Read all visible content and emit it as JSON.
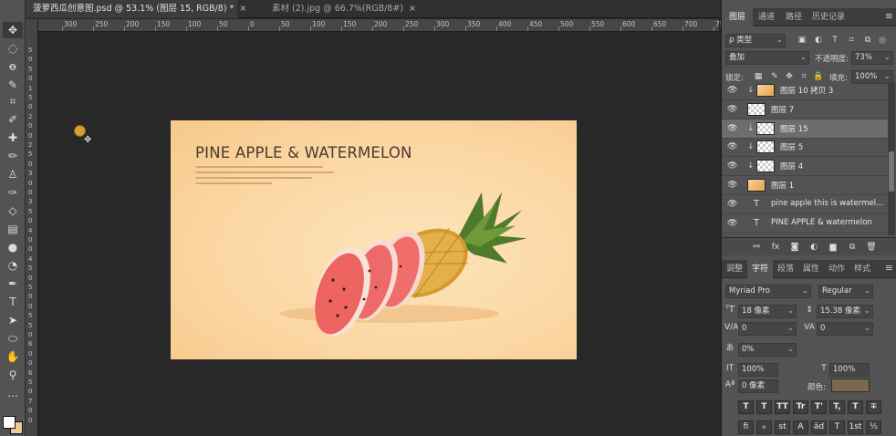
{
  "tabs": [
    {
      "label": "菠萝西瓜创意图.psd @ 53.1% (图层 15, RGB/8) *",
      "close": "×"
    },
    {
      "label": "素材 (2).jpg @ 66.7%(RGB/8#)",
      "close": "×"
    }
  ],
  "ruler": {
    "top_labels": [
      "300",
      "250",
      "200",
      "150",
      "100",
      "50",
      "0",
      "50",
      "100",
      "150",
      "200",
      "250",
      "300",
      "350",
      "400",
      "450",
      "500",
      "550",
      "600",
      "650",
      "700",
      "750"
    ],
    "left_labels": [
      "5",
      "0",
      "5",
      "0",
      "1",
      "5",
      "0",
      "2",
      "0",
      "0",
      "2",
      "5",
      "0",
      "3",
      "0",
      "0",
      "3",
      "5",
      "0",
      "4",
      "0",
      "0",
      "4",
      "5",
      "0",
      "5",
      "0",
      "0",
      "5",
      "5",
      "0",
      "6",
      "0",
      "0",
      "6",
      "5",
      "0",
      "7",
      "0",
      "0"
    ]
  },
  "toolbar": {
    "tools": [
      "move-tool",
      "marquee-tool",
      "lasso-tool",
      "quick-select-tool",
      "crop-tool",
      "eyedropper-tool",
      "healing-brush-tool",
      "brush-tool",
      "clone-stamp-tool",
      "history-brush-tool",
      "eraser-tool",
      "gradient-tool",
      "blur-tool",
      "dodge-tool",
      "pen-tool",
      "type-tool",
      "path-select-tool",
      "shape-tool",
      "hand-tool",
      "zoom-tool",
      "more-tools"
    ],
    "glyphs": [
      "✥",
      "◌",
      "ꝋ",
      "✎",
      "⌗",
      "✐",
      "✚",
      "✏",
      "♙",
      "✑",
      "◇",
      "▤",
      "●",
      "◔",
      "✒",
      "T",
      "➤",
      "⬭",
      "✋",
      "⚲",
      "…"
    ]
  },
  "artboard": {
    "title": "PINE APPLE & WATERMELON"
  },
  "layers_panel": {
    "tabs": [
      "图层",
      "通道",
      "路径",
      "历史记录"
    ],
    "filter_kind": "ρ 类型",
    "blend_mode": "叠加",
    "opacity_label": "不透明度:",
    "opacity_value": "73%",
    "lock_label": "锁定:",
    "fill_label": "填充:",
    "fill_value": "100%",
    "layers": [
      {
        "name": "图层 10 拷贝 3",
        "kind": "image",
        "clipped": true
      },
      {
        "name": "图层 7",
        "kind": "pixel",
        "clipped": false
      },
      {
        "name": "图层 15",
        "kind": "pixel",
        "clipped": true,
        "selected": true
      },
      {
        "name": "图层 5",
        "kind": "pixel",
        "clipped": true
      },
      {
        "name": "图层 4",
        "kind": "pixel",
        "clipped": true
      },
      {
        "name": "图层 1",
        "kind": "image",
        "clipped": false
      },
      {
        "name": "pine apple this is watermel...",
        "kind": "text",
        "clipped": false
      },
      {
        "name": "PINE APPLE & watermelon",
        "kind": "text",
        "clipped": false
      }
    ],
    "footer_icons": [
      "link-icon",
      "fx-icon",
      "mask-icon",
      "adjustment-icon",
      "folder-icon",
      "new-layer-icon",
      "trash-icon"
    ],
    "footer_glyphs": [
      "⚯",
      "fx",
      "◙",
      "◐",
      "▆",
      "⧉",
      "🗑"
    ]
  },
  "character_panel": {
    "tabs": [
      "调整",
      "字符",
      "段落",
      "属性",
      "动作",
      "样式"
    ],
    "font_family": "Myriad Pro",
    "font_style": "Regular",
    "size_value": "18 像素",
    "leading_value": "15.38 像素",
    "kerning_value": "0",
    "tracking_value": "0",
    "scale_pct_value": "0%",
    "vertical_scale": "100%",
    "horizontal_scale": "100%",
    "baseline_value": "0 像素",
    "color_label": "颜色:",
    "color_hex": "#7a6850",
    "style_buttons": [
      "T",
      "T",
      "TT",
      "Tr",
      "T'",
      "T,",
      "T",
      "∓"
    ],
    "opentype_buttons": [
      "fi",
      "ℴ",
      "st",
      "A",
      "ād",
      "T",
      "1st",
      "½"
    ]
  }
}
